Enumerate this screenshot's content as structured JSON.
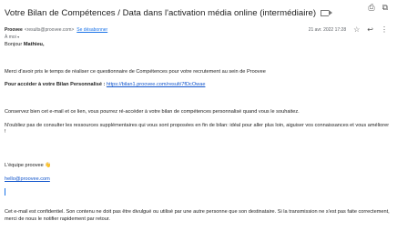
{
  "email": {
    "subject": "Votre Bilan de Compétences / Data dans l'activation média online (intermédiaire)",
    "label_icon": "label-icon",
    "actions": {
      "print": "print-icon",
      "open_new": "open-in-new-icon"
    },
    "sender": {
      "name": "Proovee",
      "email": "<results@proovee.com>",
      "unsubscribe": "Se désabonner"
    },
    "to": "À moi",
    "date": "21 avr. 2022 17:28",
    "header_icons": [
      "star-icon",
      "reply-icon",
      "more-icon"
    ],
    "greeting": "Bonjour ",
    "greeting_name": "Mathieu,",
    "p1": "Merci d'avoir pris le temps de réaliser ce questionnaire de Compétences pour votre recrutement au sein de Proovee",
    "access_label": "Pour accéder à votre Bilan Personnalisé : ",
    "access_link": "https://bilan1.proovee.com/result/7fDcOwae",
    "p2": "Conservez bien cet e-mail et ce lien, vous pourrez ré-accéder à votre bilan de compétences personnalisé quand vous le souhaitez.",
    "p3": "N'oubliez pas de consulter les ressources supplémentaires qui vous sont proposées en fin de bilan: idéal pour aller plus loin, aiguiser vos connaissances et vous améliorer !",
    "signoff": "L'équipe proovee",
    "signoff_emoji": "👋",
    "contact_link": "hello@proovee.com",
    "footer": "Cet e-mail est confidentiel. Son contenu ne doit pas être divulgué ou utilisé par une autre personne que son destinataire. Si la transmission ne s'est pas faite correctement, merci de nous le notifier rapidement par retour."
  }
}
